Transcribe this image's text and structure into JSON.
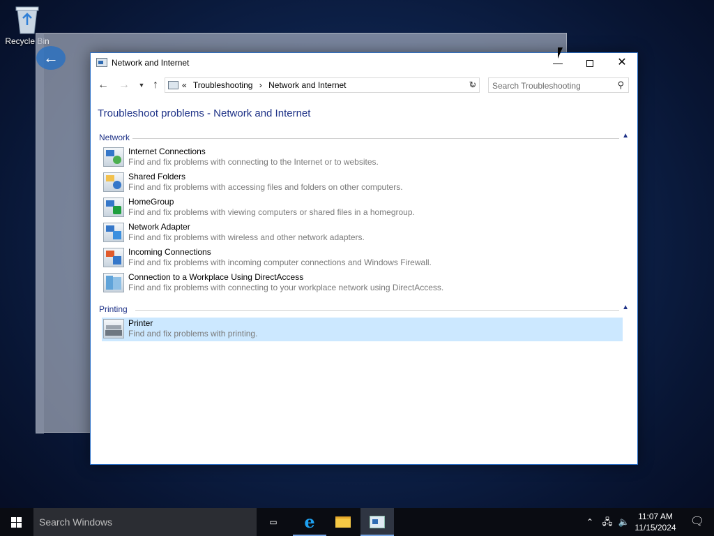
{
  "desktop": {
    "recycle_bin_label": "Recycle Bin"
  },
  "window": {
    "title": "Network and Internet",
    "nav": {
      "back_icon": "arrow-left",
      "forward_icon": "arrow-right",
      "recent_icon": "chevron-down",
      "up_icon": "arrow-up"
    },
    "breadcrumb": {
      "prefix": "«",
      "items": [
        "Troubleshooting",
        "Network and Internet"
      ],
      "separator": "›"
    },
    "search_placeholder": "Search Troubleshooting",
    "page_title": "Troubleshoot problems - Network and Internet",
    "sections": [
      {
        "title": "Network",
        "items": [
          {
            "name": "Internet Connections",
            "description": "Find and fix problems with connecting to the Internet or to websites."
          },
          {
            "name": "Shared Folders",
            "description": "Find and fix problems with accessing files and folders on other computers."
          },
          {
            "name": "HomeGroup",
            "description": "Find and fix problems with viewing computers or shared files in a homegroup."
          },
          {
            "name": "Network Adapter",
            "description": "Find and fix problems with wireless and other network adapters."
          },
          {
            "name": "Incoming Connections",
            "description": "Find and fix problems with incoming computer connections and Windows Firewall."
          },
          {
            "name": "Connection to a Workplace Using DirectAccess",
            "description": "Find and fix problems with connecting to your workplace network using DirectAccess."
          }
        ]
      },
      {
        "title": "Printing",
        "items": [
          {
            "name": "Printer",
            "description": "Find and fix problems with printing.",
            "selected": true
          }
        ]
      }
    ]
  },
  "taskbar": {
    "search_placeholder": "Search Windows",
    "clock": {
      "time": "11:07 AM",
      "date": "11/15/2024"
    },
    "colors": {
      "accent": "#7aa9e8",
      "selection": "#cce8ff",
      "heading": "#1e3287"
    }
  }
}
